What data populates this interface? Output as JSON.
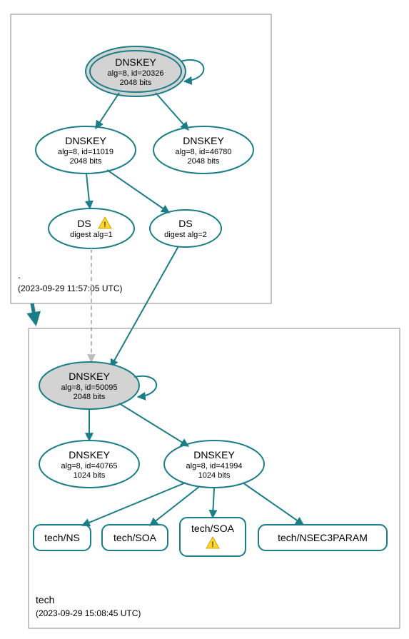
{
  "zones": {
    "root": {
      "label": ".",
      "date": "(2023-09-29 11:57:05 UTC)",
      "nodes": {
        "ksk": {
          "title": "DNSKEY",
          "line2": "alg=8, id=20326",
          "line3": "2048 bits"
        },
        "dnskey1": {
          "title": "DNSKEY",
          "line2": "alg=8, id=11019",
          "line3": "2048 bits"
        },
        "dnskey2": {
          "title": "DNSKEY",
          "line2": "alg=8, id=46780",
          "line3": "2048 bits"
        },
        "ds1": {
          "title": "DS",
          "line2": "digest alg=1",
          "warn": true
        },
        "ds2": {
          "title": "DS",
          "line2": "digest alg=2"
        }
      }
    },
    "tech": {
      "label": "tech",
      "date": "(2023-09-29 15:08:45 UTC)",
      "nodes": {
        "ksk": {
          "title": "DNSKEY",
          "line2": "alg=8, id=50095",
          "line3": "2048 bits"
        },
        "dnskey1": {
          "title": "DNSKEY",
          "line2": "alg=8, id=40765",
          "line3": "1024 bits"
        },
        "dnskey2": {
          "title": "DNSKEY",
          "line2": "alg=8, id=41994",
          "line3": "1024 bits"
        },
        "rr1": {
          "title": "tech/NS"
        },
        "rr2": {
          "title": "tech/SOA"
        },
        "rr3": {
          "title": "tech/SOA",
          "warn": true
        },
        "rr4": {
          "title": "tech/NSEC3PARAM"
        }
      }
    }
  },
  "colors": {
    "teal": "#1b7d87",
    "kskFill": "#d3d3d3",
    "zoneBorder": "#888888",
    "warnFill": "#ffd633",
    "warnStroke": "#d1a300",
    "dashed": "#bdbdbd"
  }
}
